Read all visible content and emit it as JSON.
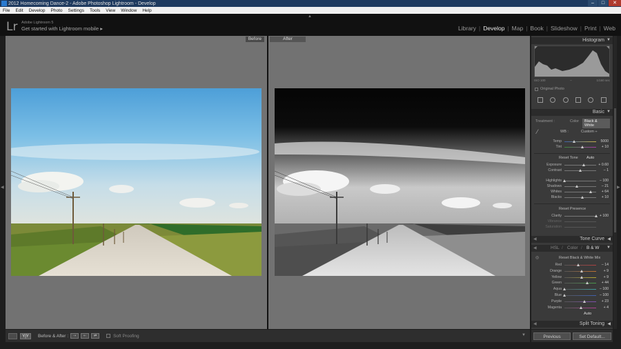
{
  "window": {
    "title": "2012 Homecoming Dance-2 - Adobe Photoshop Lightroom - Develop",
    "controls": [
      "–",
      "□",
      "✕"
    ]
  },
  "menu": [
    "File",
    "Edit",
    "Develop",
    "Photo",
    "Settings",
    "Tools",
    "View",
    "Window",
    "Help"
  ],
  "identity": {
    "logo": "Lr",
    "product": "Adobe Lightroom 5",
    "mobile_prompt": "Get started with Lightroom mobile ▸"
  },
  "modules": {
    "items": [
      "Library",
      "Develop",
      "Map",
      "Book",
      "Slideshow",
      "Print",
      "Web"
    ],
    "active": "Develop"
  },
  "view": {
    "before_label": "Before",
    "after_label": "After"
  },
  "toolbar": {
    "yy_label": "Y|Y",
    "before_after_label": "Before & After :",
    "soft_proofing": "Soft Proofing"
  },
  "panel": {
    "histogram_title": "Histogram",
    "hist_info": [
      "ISO 100",
      "–",
      "1/160 sec"
    ],
    "original_photo": "Original Photo",
    "basic_title": "Basic",
    "treatment_label": "Treatment :",
    "treatment_color": "Color",
    "treatment_bw": "Black & White",
    "wb_label": "WB :",
    "wb_value": "Custom ÷",
    "temp_label": "Temp",
    "temp_value": "5000",
    "tint_label": "Tint",
    "tint_value": "+ 10",
    "reset_tone": "Reset Tone",
    "auto": "Auto",
    "exposure_label": "Exposure",
    "exposure_value": "+ 0.60",
    "contrast_label": "Contrast",
    "contrast_value": "– 1",
    "highlights_label": "Highlights",
    "highlights_value": "– 100",
    "shadows_label": "Shadows",
    "shadows_value": "– 21",
    "whites_label": "Whites",
    "whites_value": "+ 64",
    "blacks_label": "Blacks",
    "blacks_value": "+ 10",
    "reset_presence": "Reset Presence",
    "clarity_label": "Clarity",
    "clarity_value": "+ 100",
    "vibrance_label": "Vibrance",
    "saturation_label": "Saturation",
    "tone_curve_title": "Tone Curve",
    "hsl_tabs": [
      "HSL",
      "/",
      "Color",
      "/",
      "B & W"
    ],
    "reset_bw_mix": "Reset Black & White Mix",
    "bw_mix": [
      {
        "name": "Red",
        "value": "– 14",
        "pos": 0.43
      },
      {
        "name": "Orange",
        "value": "+ 9",
        "pos": 0.55
      },
      {
        "name": "Yellow",
        "value": "+ 9",
        "pos": 0.55
      },
      {
        "name": "Green",
        "value": "+ 44",
        "pos": 0.72
      },
      {
        "name": "Aqua",
        "value": "– 100",
        "pos": 0.0
      },
      {
        "name": "Blue",
        "value": "– 100",
        "pos": 0.0
      },
      {
        "name": "Purple",
        "value": "+ 23",
        "pos": 0.62
      },
      {
        "name": "Magenta",
        "value": "+ 4",
        "pos": 0.52
      }
    ],
    "bw_auto": "Auto",
    "split_toning_title": "Split Toning",
    "previous": "Previous",
    "set_default": "Set Default..."
  },
  "colors": {
    "accent_blue": "#1e3a5f",
    "panel_bg": "#3a3a3a",
    "view_bg": "#727272"
  }
}
